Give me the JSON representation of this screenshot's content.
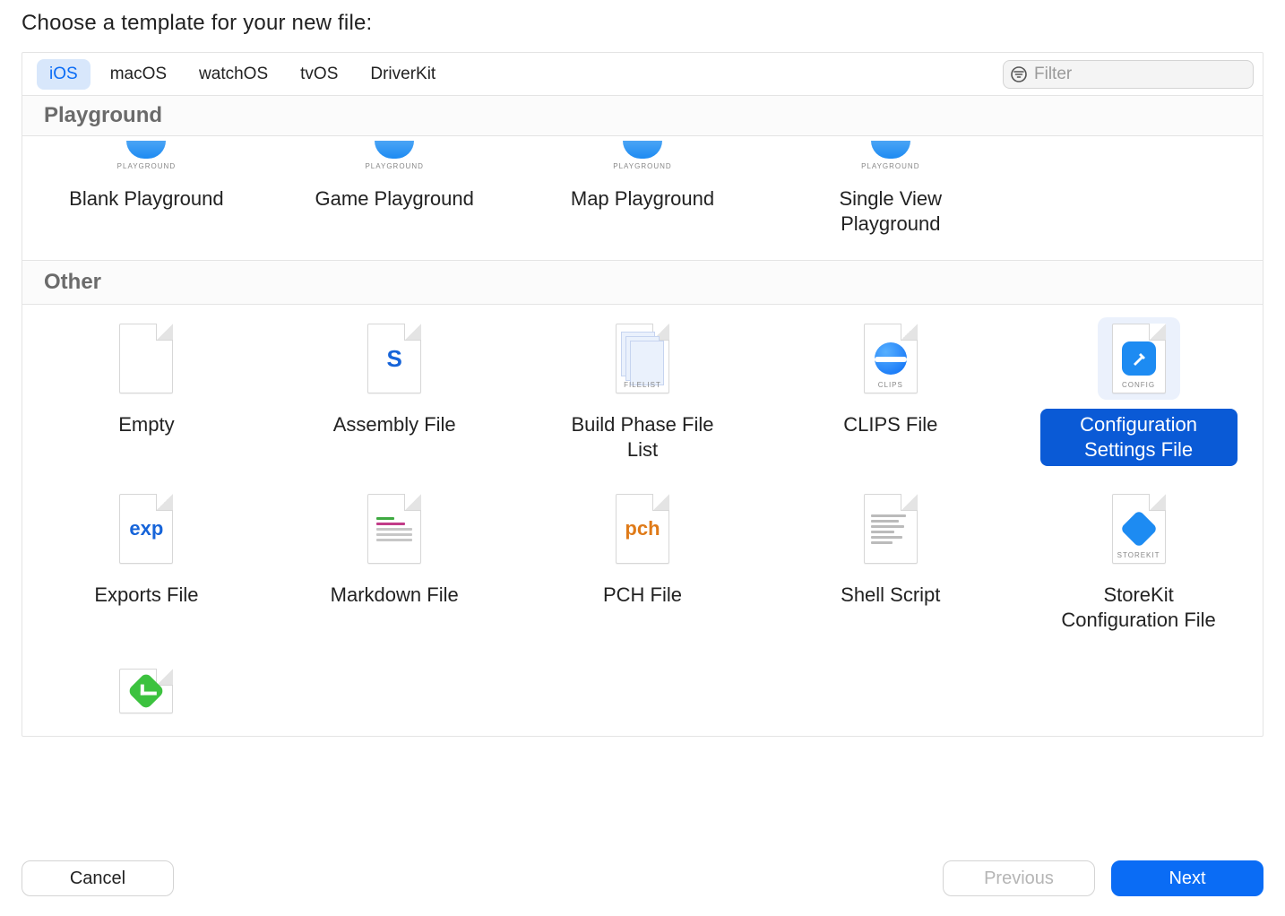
{
  "heading": "Choose a template for your new file:",
  "tabs": [
    "iOS",
    "macOS",
    "watchOS",
    "tvOS",
    "DriverKit"
  ],
  "active_tab": 0,
  "filter": {
    "placeholder": "Filter",
    "value": ""
  },
  "sections": {
    "playground": {
      "title": "Playground",
      "items": [
        {
          "label": "Blank Playground",
          "icon": "bird-icon",
          "tag": "PLAYGROUND"
        },
        {
          "label": "Game Playground",
          "icon": "bird-icon",
          "tag": "PLAYGROUND"
        },
        {
          "label": "Map Playground",
          "icon": "bird-icon",
          "tag": "PLAYGROUND"
        },
        {
          "label": "Single View Playground",
          "icon": "bird-icon",
          "tag": "PLAYGROUND"
        }
      ]
    },
    "other": {
      "title": "Other",
      "items": [
        {
          "label": "Empty",
          "icon": "blank-file-icon"
        },
        {
          "label": "Assembly File",
          "icon": "letter-icon",
          "letter": "S",
          "color": "blue"
        },
        {
          "label": "Build Phase File List",
          "icon": "stack-icon",
          "tag": "FILELIST"
        },
        {
          "label": "CLIPS File",
          "icon": "sphere-icon",
          "tag": "CLIPS"
        },
        {
          "label": "Configuration Settings File",
          "icon": "hammer-icon",
          "tag": "CONFIG",
          "selected": true
        },
        {
          "label": "Exports File",
          "icon": "text-icon",
          "text": "exp",
          "color": "blue"
        },
        {
          "label": "Markdown File",
          "icon": "lines-icon"
        },
        {
          "label": "PCH File",
          "icon": "text-icon",
          "text": "pch",
          "color": "orange"
        },
        {
          "label": "Shell Script",
          "icon": "script-icon"
        },
        {
          "label": "StoreKit Configuration File",
          "icon": "diamond-icon",
          "tag": "STOREKIT"
        }
      ],
      "partial_next_row": [
        {
          "label": "",
          "icon": "check-icon"
        }
      ]
    }
  },
  "footer": {
    "cancel": "Cancel",
    "previous": "Previous",
    "next": "Next"
  }
}
